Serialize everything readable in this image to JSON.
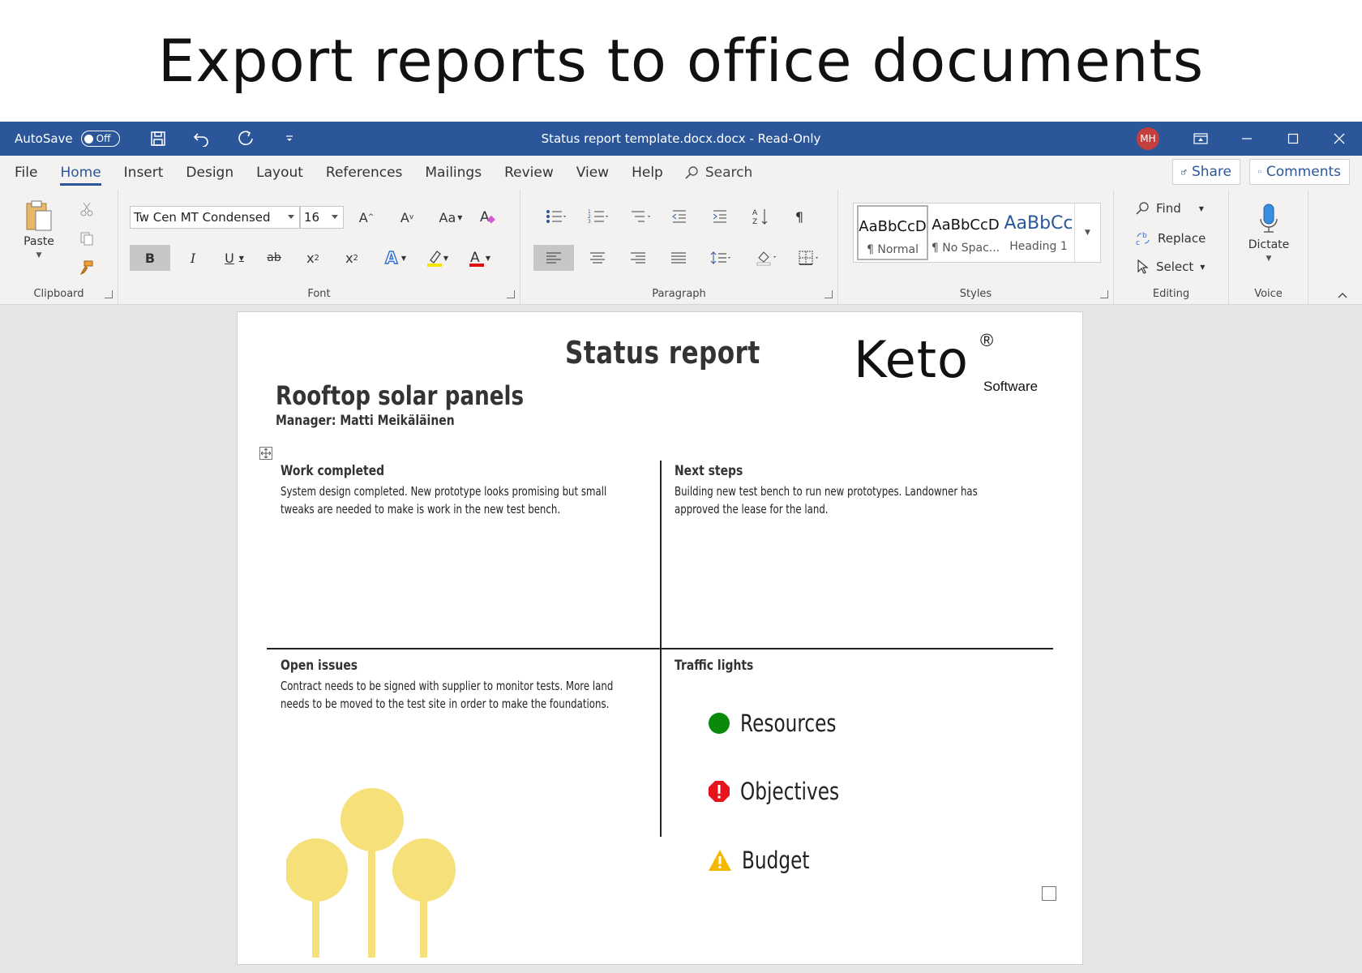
{
  "headline": "Export reports to office documents",
  "titlebar": {
    "autosave_label": "AutoSave",
    "autosave_state": "Off",
    "document_title": "Status report template.docx.docx  -  Read-Only",
    "user_initials": "MH"
  },
  "menu": {
    "tabs": [
      "File",
      "Home",
      "Insert",
      "Design",
      "Layout",
      "References",
      "Mailings",
      "Review",
      "View",
      "Help"
    ],
    "active_tab": "Home",
    "search_label": "Search",
    "share_label": "Share",
    "comments_label": "Comments"
  },
  "ribbon": {
    "clipboard": {
      "paste_label": "Paste",
      "group_label": "Clipboard"
    },
    "font": {
      "font_name": "Tw Cen MT Condensed",
      "font_size": "16",
      "group_label": "Font",
      "case_label": "Aa"
    },
    "paragraph": {
      "group_label": "Paragraph"
    },
    "styles": {
      "group_label": "Styles",
      "items": [
        {
          "sample": "AaBbCcD",
          "name": "¶ Normal"
        },
        {
          "sample": "AaBbCcD",
          "name": "¶ No Spac..."
        },
        {
          "sample": "AaBbCc",
          "name": "Heading 1"
        }
      ]
    },
    "editing": {
      "find_label": "Find",
      "replace_label": "Replace",
      "select_label": "Select",
      "group_label": "Editing"
    },
    "voice": {
      "dictate_label": "Dictate",
      "group_label": "Voice"
    }
  },
  "document": {
    "title": "Status report",
    "logo_word": "Keto",
    "logo_mark": "®",
    "logo_sub": "Software",
    "project_name": "Rooftop solar panels",
    "manager_line": "Manager: Matti Meikäläinen",
    "cells": {
      "work_completed": {
        "heading": "Work completed",
        "text": "System design completed. New prototype looks promising but small tweaks are needed to make is work in the new test bench."
      },
      "next_steps": {
        "heading": "Next steps",
        "text": "Building new test  bench to run new prototypes. Landowner has approved the lease for the land."
      },
      "open_issues": {
        "heading": "Open issues",
        "text": "Contract needs to be signed with supplier to monitor tests. More land needs to be moved to the test site in order to make the foundations."
      },
      "traffic_lights": {
        "heading": "Traffic lights",
        "items": [
          {
            "label": "Resources",
            "status": "green",
            "color": "#0a8a0a"
          },
          {
            "label": "Objectives",
            "status": "red",
            "color": "#e8141c"
          },
          {
            "label": "Budget",
            "status": "warning",
            "color": "#f5b800"
          }
        ]
      }
    }
  },
  "colors": {
    "word_blue": "#2b579a",
    "ribbon_bg": "#f3f2f1",
    "tree_yellow": "#f5e07a"
  }
}
